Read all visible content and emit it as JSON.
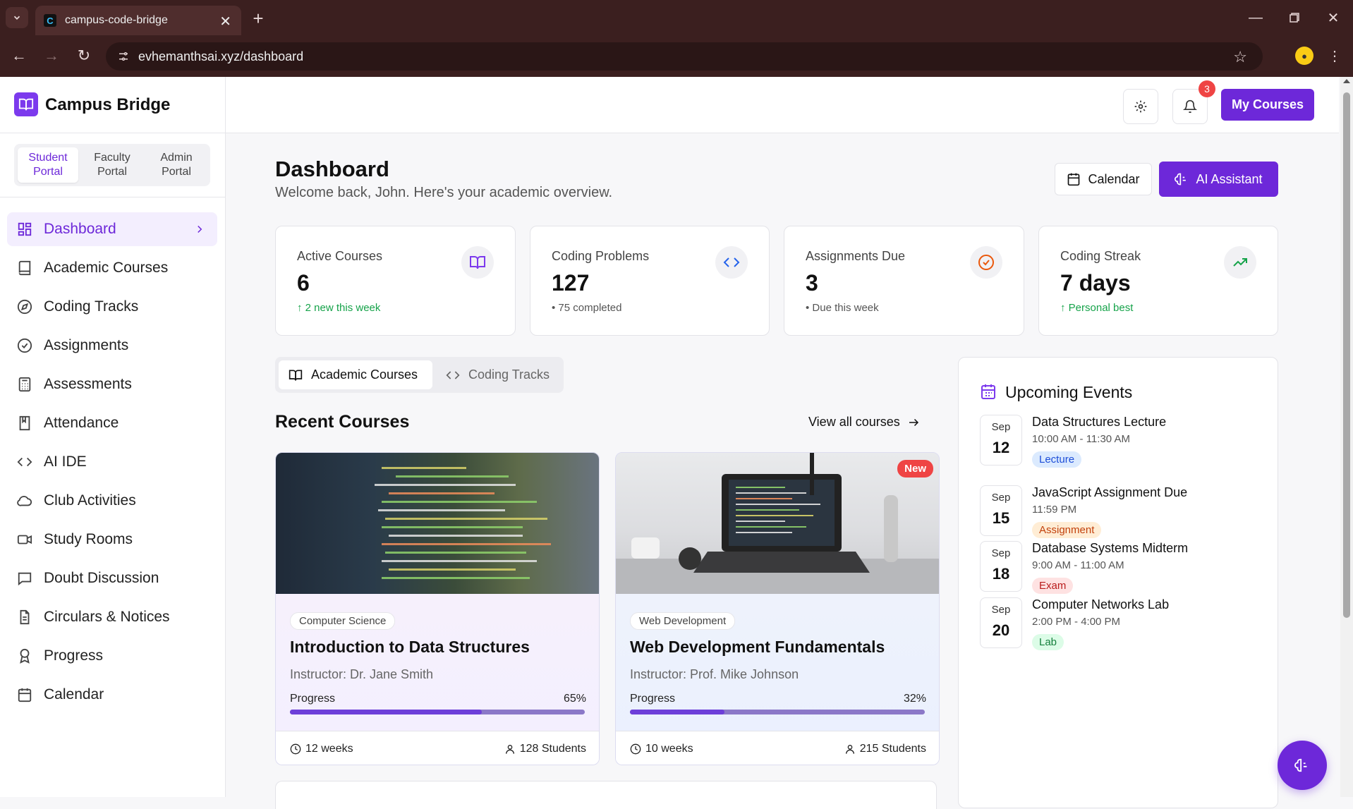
{
  "browser": {
    "tab_title": "campus-code-bridge",
    "url": "evhemanthsai.xyz/dashboard"
  },
  "app": {
    "name": "Campus Bridge",
    "accent": "#6d28d9"
  },
  "portals": [
    {
      "label": "Student Portal",
      "active": true
    },
    {
      "label": "Faculty Portal",
      "active": false
    },
    {
      "label": "Admin Portal",
      "active": false
    }
  ],
  "nav": [
    {
      "label": "Dashboard",
      "icon": "grid-icon",
      "active": true
    },
    {
      "label": "Academic Courses",
      "icon": "book-icon"
    },
    {
      "label": "Coding Tracks",
      "icon": "compass-icon"
    },
    {
      "label": "Assignments",
      "icon": "check-circle-icon"
    },
    {
      "label": "Assessments",
      "icon": "calculator-icon"
    },
    {
      "label": "Attendance",
      "icon": "bookmark-book-icon"
    },
    {
      "label": "AI IDE",
      "icon": "code-icon"
    },
    {
      "label": "Club Activities",
      "icon": "cloud-icon"
    },
    {
      "label": "Study Rooms",
      "icon": "video-icon"
    },
    {
      "label": "Doubt Discussion",
      "icon": "message-icon"
    },
    {
      "label": "Circulars & Notices",
      "icon": "file-text-icon"
    },
    {
      "label": "Progress",
      "icon": "award-icon"
    },
    {
      "label": "Calendar",
      "icon": "calendar-icon"
    }
  ],
  "header": {
    "notification_count": "3",
    "my_courses": "My Courses"
  },
  "page": {
    "title": "Dashboard",
    "subtitle": "Welcome back, John. Here's your academic overview.",
    "calendar_button": "Calendar",
    "ai_button": "AI Assistant"
  },
  "stats": [
    {
      "label": "Active Courses",
      "value": "6",
      "sub": "↑ 2 new this week",
      "sub_color": "#16a34a",
      "icon": "book-open-icon",
      "icon_color": "#7c3aed"
    },
    {
      "label": "Coding Problems",
      "value": "127",
      "sub": "• 75 completed",
      "sub_color": "#555555",
      "icon": "code-icon",
      "icon_color": "#2563eb"
    },
    {
      "label": "Assignments Due",
      "value": "3",
      "sub": "• Due this week",
      "sub_color": "#555555",
      "icon": "check-circle-icon",
      "icon_color": "#ea580c"
    },
    {
      "label": "Coding Streak",
      "value": "7 days",
      "sub": "↑ Personal best",
      "sub_color": "#16a34a",
      "icon": "trending-up-icon",
      "icon_color": "#16a34a"
    }
  ],
  "tabs": [
    {
      "label": "Academic Courses",
      "active": true
    },
    {
      "label": "Coding Tracks",
      "active": false
    }
  ],
  "recent": {
    "title": "Recent Courses",
    "view_all": "View all courses"
  },
  "courses": [
    {
      "tag": "Computer Science",
      "title": "Introduction to Data Structures",
      "instructor": "Instructor: Dr. Jane Smith",
      "progress_label": "Progress",
      "progress": 65,
      "progress_text": "65%",
      "weeks": "12 weeks",
      "students": "128 Students",
      "new": false
    },
    {
      "tag": "Web Development",
      "title": "Web Development Fundamentals",
      "instructor": "Instructor: Prof. Mike Johnson",
      "progress_label": "Progress",
      "progress": 32,
      "progress_text": "32%",
      "weeks": "10 weeks",
      "students": "215 Students",
      "new": true,
      "new_label": "New"
    }
  ],
  "events": {
    "title": "Upcoming Events",
    "items": [
      {
        "month": "Sep",
        "day": "12",
        "title": "Data Structures Lecture",
        "time": "10:00 AM - 11:30 AM",
        "type": "Lecture",
        "bg": "#dbeafe",
        "fg": "#1d4ed8"
      },
      {
        "month": "Sep",
        "day": "15",
        "title": "JavaScript Assignment Due",
        "time": "11:59 PM",
        "type": "Assignment",
        "bg": "#ffedd5",
        "fg": "#c2410c"
      },
      {
        "month": "Sep",
        "day": "18",
        "title": "Database Systems Midterm",
        "time": "9:00 AM - 11:00 AM",
        "type": "Exam",
        "bg": "#fee2e2",
        "fg": "#b91c1c"
      },
      {
        "month": "Sep",
        "day": "20",
        "title": "Computer Networks Lab",
        "time": "2:00 PM - 4:00 PM",
        "type": "Lab",
        "bg": "#dcfce7",
        "fg": "#15803d"
      }
    ]
  }
}
